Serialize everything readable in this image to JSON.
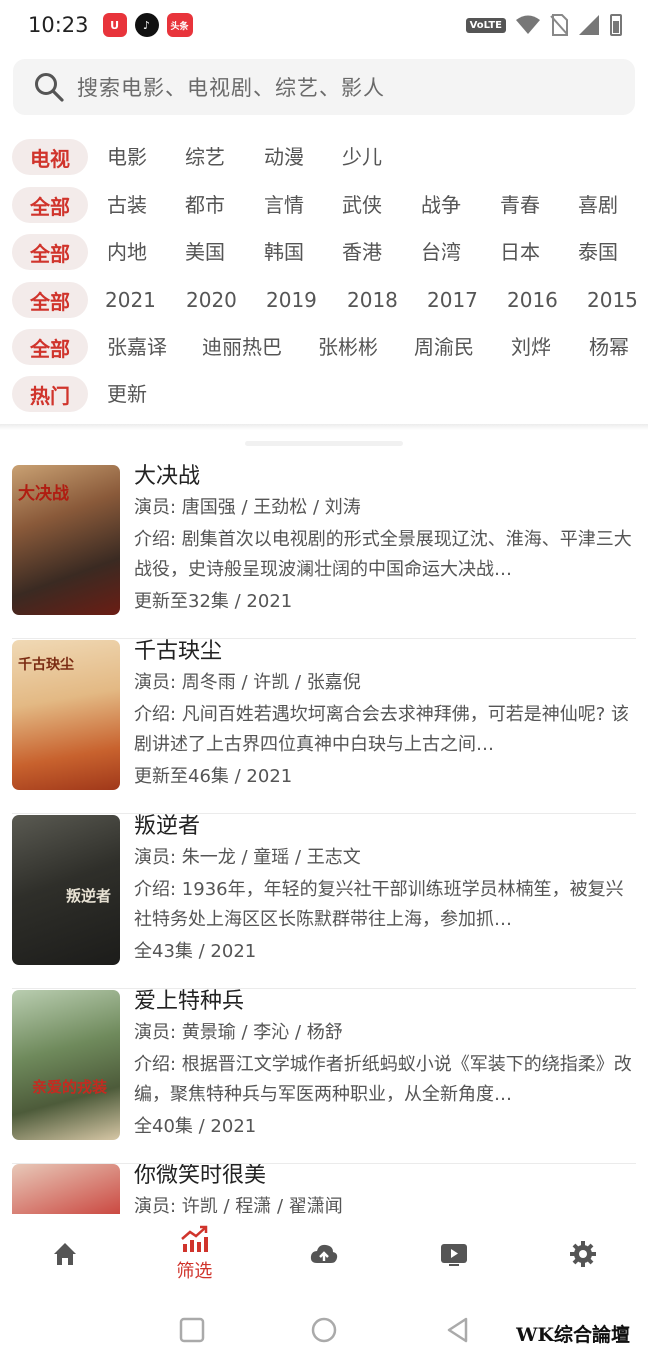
{
  "status_bar": {
    "time": "10:23",
    "apps": [
      {
        "name": "app-red-icon",
        "glyph": "U"
      },
      {
        "name": "tiktok-icon",
        "glyph": "♪"
      },
      {
        "name": "toutiao-icon",
        "glyph": "头条"
      }
    ],
    "volte": "VoLTE"
  },
  "search": {
    "placeholder": "搜索电影、电视剧、综艺、影人"
  },
  "filters": [
    {
      "selected": "电视",
      "options": [
        "电影",
        "综艺",
        "动漫",
        "少儿"
      ]
    },
    {
      "selected": "全部",
      "options": [
        "古装",
        "都市",
        "言情",
        "武侠",
        "战争",
        "青春",
        "喜剧"
      ]
    },
    {
      "selected": "全部",
      "options": [
        "内地",
        "美国",
        "韩国",
        "香港",
        "台湾",
        "日本",
        "泰国"
      ]
    },
    {
      "selected": "全部",
      "options": [
        "2021",
        "2020",
        "2019",
        "2018",
        "2017",
        "2016",
        "2015"
      ]
    },
    {
      "selected": "全部",
      "options": [
        "张嘉译",
        "迪丽热巴",
        "张彬彬",
        "周渝民",
        "刘烨",
        "杨幂"
      ]
    },
    {
      "selected": "热门",
      "options": [
        "更新"
      ]
    }
  ],
  "list": [
    {
      "title": "大决战",
      "cast": "演员: 唐国强 / 王劲松 / 刘涛",
      "desc": "介绍: 剧集首次以电视剧的形式全景展现辽沈、淮海、平津三大战役，史诗般呈现波澜壮阔的中国命运大决战…",
      "meta": "更新至32集 / 2021",
      "poster_text": "大决战"
    },
    {
      "title": "千古玦尘",
      "cast": "演员: 周冬雨 / 许凯 / 张嘉倪",
      "desc": "介绍: 凡间百姓若遇坎坷离合会去求神拜佛，可若是神仙呢? 该剧讲述了上古界四位真神中白玦与上古之间…",
      "meta": "更新至46集 / 2021",
      "poster_text": "千古玦尘"
    },
    {
      "title": "叛逆者",
      "cast": "演员: 朱一龙 / 童瑶 / 王志文",
      "desc": "介绍: 1936年，年轻的复兴社干部训练班学员林楠笙，被复兴社特务处上海区区长陈默群带往上海，参加抓…",
      "meta": "全43集 / 2021",
      "poster_text": "叛逆者"
    },
    {
      "title": "爱上特种兵",
      "cast": "演员: 黄景瑜 / 李沁 / 杨舒",
      "desc": "介绍: 根据晋江文学城作者折纸蚂蚁小说《军装下的绕指柔》改编，聚焦特种兵与军医两种职业，从全新角度…",
      "meta": "全40集 / 2021",
      "poster_text": "亲爱的戎装"
    },
    {
      "title": "你微笑时很美",
      "cast": "演员: 许凯 / 程潇 / 翟潇闻",
      "desc": "",
      "meta": "",
      "poster_text": ""
    }
  ],
  "bottom_nav": {
    "items": [
      {
        "name": "home",
        "label": ""
      },
      {
        "name": "filter",
        "label": "筛选"
      },
      {
        "name": "cloud-upload",
        "label": ""
      },
      {
        "name": "video",
        "label": ""
      },
      {
        "name": "settings",
        "label": ""
      }
    ],
    "active_color": "#d0342c",
    "inactive_color": "#555555"
  },
  "watermark": "WK综合論壇",
  "colors": {
    "accent": "#d0342c",
    "pill_bg": "#f3ebea"
  }
}
